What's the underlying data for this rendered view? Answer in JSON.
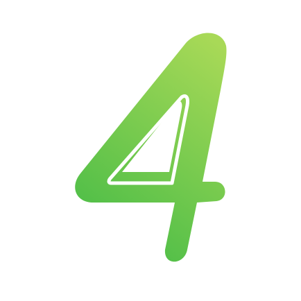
{
  "logo": {
    "icon": "number-four-logo-icon",
    "gradient_start": "#a8d957",
    "gradient_end": "#4bbd47",
    "background": "#ffffff"
  }
}
